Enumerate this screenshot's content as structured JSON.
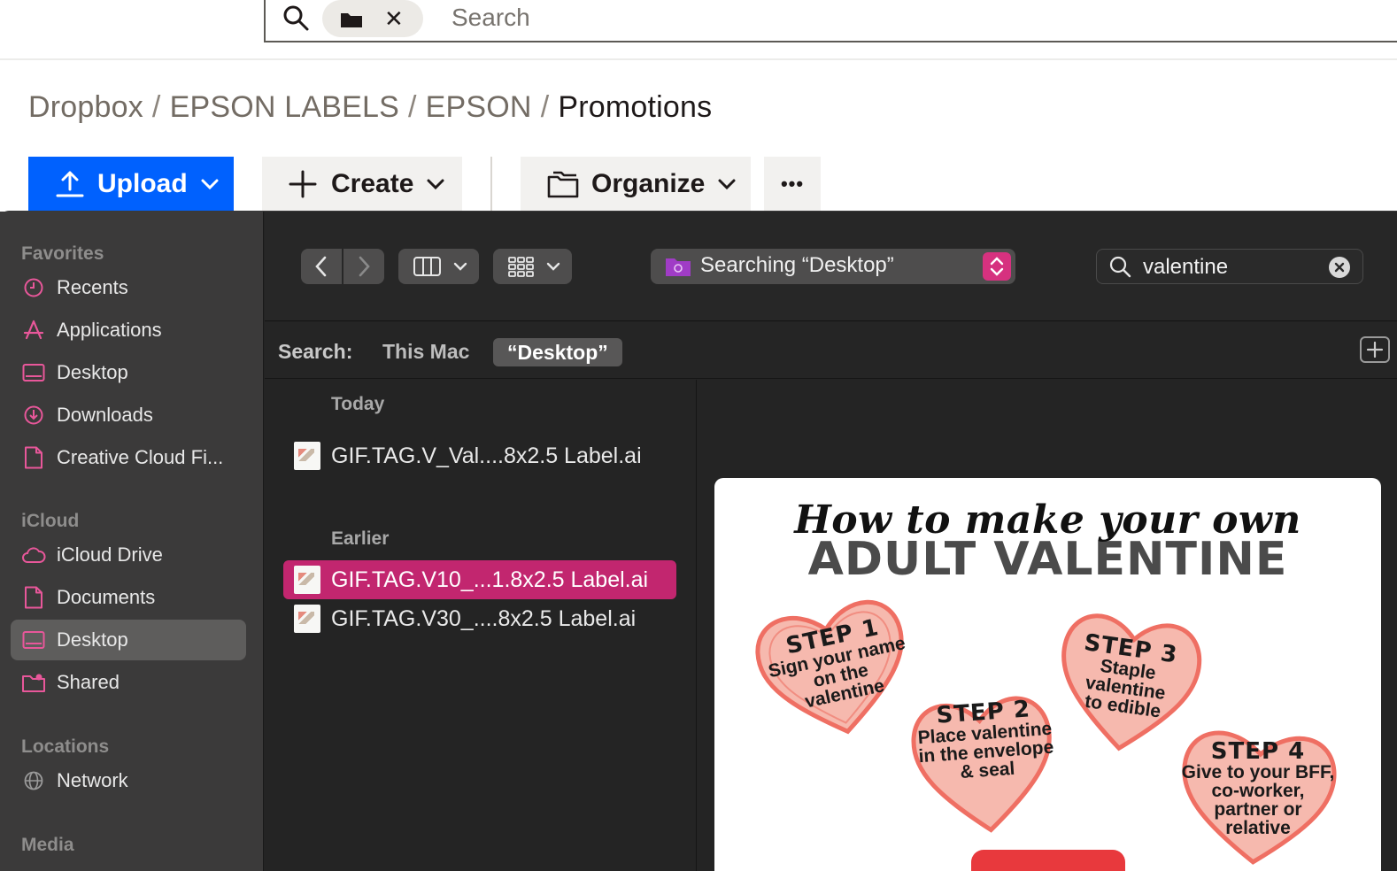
{
  "search": {
    "placeholder": "Search"
  },
  "breadcrumb": {
    "items": [
      "Dropbox",
      "EPSON LABELS",
      "EPSON"
    ],
    "current": "Promotions"
  },
  "toolbar": {
    "upload_label": "Upload",
    "create_label": "Create",
    "organize_label": "Organize",
    "more_label": "•••"
  },
  "sidebar": {
    "favorites_title": "Favorites",
    "favorites": [
      "Recents",
      "Applications",
      "Desktop",
      "Downloads",
      "Creative Cloud Fi..."
    ],
    "icloud_title": "iCloud",
    "icloud": [
      "iCloud Drive",
      "Documents",
      "Desktop",
      "Shared"
    ],
    "locations_title": "Locations",
    "locations": [
      "Network"
    ],
    "media_title": "Media",
    "accent_color": "#e8579a"
  },
  "finder": {
    "scope_popup_label": "Searching “Desktop”",
    "search_value": "valentine",
    "scope_bar": {
      "label": "Search:",
      "this_mac": "This Mac",
      "desktop": "“Desktop”"
    },
    "groups": [
      {
        "title": "Today",
        "files": [
          "GIF.TAG.V_Val....8x2.5 Label.ai"
        ]
      },
      {
        "title": "Earlier",
        "files": [
          "GIF.TAG.V10_...1.8x2.5 Label.ai",
          "GIF.TAG.V30_....8x2.5 Label.ai"
        ]
      }
    ],
    "selected_color": "#c2266f"
  },
  "preview": {
    "script_title": "How to make your own",
    "headline": "ADULT VALENTINE",
    "steps": [
      {
        "step": "STEP 1",
        "desc": [
          "Sign your name",
          "on the",
          "valentine"
        ]
      },
      {
        "step": "STEP 2",
        "desc": [
          "Place valentine",
          "in the envelope",
          "& seal"
        ]
      },
      {
        "step": "STEP 3",
        "desc": [
          "Staple",
          "valentine",
          "to edible"
        ]
      },
      {
        "step": "STEP 4",
        "desc": [
          "Give to your BFF,",
          "co-worker,",
          "partner or",
          "relative"
        ]
      }
    ],
    "heart_fill": "#f6b9ae",
    "heart_stroke": "#ef6f63"
  }
}
